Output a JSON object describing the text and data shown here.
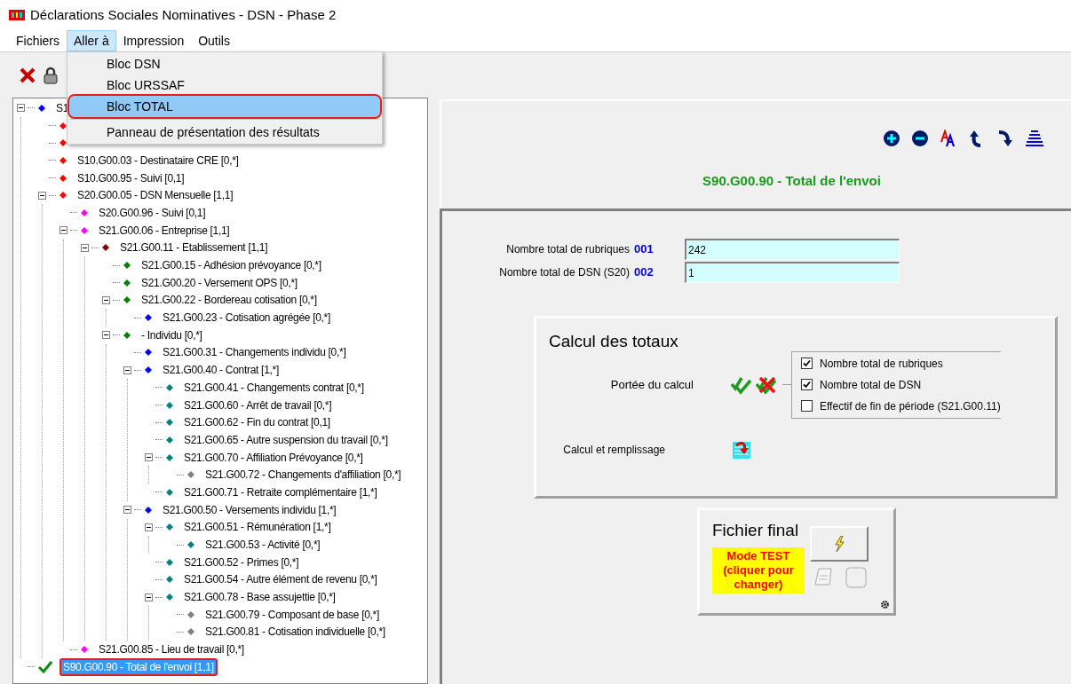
{
  "window": {
    "title": "Déclarations Sociales Nominatives - DSN - Phase 2"
  },
  "menu_bar": [
    {
      "label": "Fichiers",
      "selected": false
    },
    {
      "label": "Aller à",
      "selected": true
    },
    {
      "label": "Impression",
      "selected": false
    },
    {
      "label": "Outils",
      "selected": false
    }
  ],
  "dropdown": [
    {
      "label": "Bloc DSN",
      "selected": false,
      "kind": "item"
    },
    {
      "label": "Bloc URSSAF",
      "selected": false,
      "kind": "item"
    },
    {
      "label": "Bloc TOTAL",
      "selected": true,
      "kind": "item"
    },
    {
      "kind": "separator"
    },
    {
      "label": "Panneau de présentation des résultats",
      "selected": false,
      "kind": "item"
    }
  ],
  "tree": [
    {
      "label": "S1",
      "color": "#0000ff",
      "kind": "diamond",
      "selected": false,
      "expanded": true,
      "children": [
        {
          "color": "#ff0000",
          "kind": "diamond",
          "selected": false
        },
        {
          "color": "#ff0000",
          "kind": "diamond",
          "selected": false
        },
        {
          "label": "S10.G00.03 - Destinataire CRE [0,*]",
          "color": "#ff0000",
          "kind": "diamond",
          "selected": false
        },
        {
          "label": "S10.G00.95 - Suivi [0,1]",
          "color": "#ff0000",
          "kind": "diamond",
          "selected": false
        },
        {
          "label": "S20.G00.05 - DSN Mensuelle [1,1]",
          "color": "#ff0000",
          "kind": "diamond",
          "selected": false,
          "expanded": true,
          "children": [
            {
              "label": "S20.G00.96 - Suivi [0,1]",
              "color": "#ff00ff",
              "kind": "diamond",
              "selected": false
            },
            {
              "label": "S21.G00.06 - Entreprise [1,1]",
              "color": "#ff00ff",
              "kind": "diamond",
              "selected": false,
              "expanded": true,
              "children": [
                {
                  "label": "S21.G00.11 - Etablissement [1,1]",
                  "color": "#800000",
                  "kind": "diamond",
                  "selected": false,
                  "expanded": true,
                  "children": [
                    {
                      "label": "S21.G00.15 - Adhésion prévoyance [0,*]",
                      "color": "#008000",
                      "kind": "diamond",
                      "selected": false
                    },
                    {
                      "label": "S21.G00.20 - Versement OPS [0,*]",
                      "color": "#008000",
                      "kind": "diamond",
                      "selected": false
                    },
                    {
                      "label": "S21.G00.22 - Bordereau cotisation [0,*]",
                      "color": "#008000",
                      "kind": "diamond",
                      "selected": false,
                      "expanded": true,
                      "children": [
                        {
                          "label": "S21.G00.23 - Cotisation agrégée [0,*]",
                          "color": "#0000ff",
                          "kind": "diamond",
                          "selected": false
                        }
                      ]
                    },
                    {
                      "label": "- Individu [0,*]",
                      "color": "#008000",
                      "kind": "diamond",
                      "selected": false,
                      "expanded": true,
                      "children": [
                        {
                          "label": "S21.G00.31 - Changements individu [0,*]",
                          "color": "#0000ff",
                          "kind": "diamond",
                          "selected": false
                        },
                        {
                          "label": "S21.G00.40 - Contrat [1,*]",
                          "color": "#0000ff",
                          "kind": "diamond",
                          "selected": false,
                          "expanded": true,
                          "children": [
                            {
                              "label": "S21.G00.41 - Changements contrat [0,*]",
                              "color": "#008080",
                              "kind": "diamond",
                              "selected": false
                            },
                            {
                              "label": "S21.G00.60 - Arrêt de travail [0,*]",
                              "color": "#008080",
                              "kind": "diamond",
                              "selected": false
                            },
                            {
                              "label": "S21.G00.62 - Fin du contrat [0,1]",
                              "color": "#008080",
                              "kind": "diamond",
                              "selected": false
                            },
                            {
                              "label": "S21.G00.65 - Autre suspension du travail [0,*]",
                              "color": "#008080",
                              "kind": "diamond",
                              "selected": false
                            },
                            {
                              "label": "S21.G00.70 - Affiliation Prévoyance [0,*]",
                              "color": "#008080",
                              "kind": "diamond",
                              "selected": false,
                              "expanded": true,
                              "children": [
                                {
                                  "label": "S21.G00.72 - Changements d'affiliation [0,*]",
                                  "color": "#808080",
                                  "kind": "diamond",
                                  "selected": false
                                }
                              ]
                            },
                            {
                              "label": "S21.G00.71 - Retraite complémentaire [1,*]",
                              "color": "#008080",
                              "kind": "diamond",
                              "selected": false
                            }
                          ]
                        },
                        {
                          "label": "S21.G00.50 - Versements individu [1,*]",
                          "color": "#0000ff",
                          "kind": "diamond",
                          "selected": false,
                          "expanded": true,
                          "children": [
                            {
                              "label": "S21.G00.51 - Rémunération [1,*]",
                              "color": "#008080",
                              "kind": "diamond",
                              "selected": false,
                              "expanded": true,
                              "children": [
                                {
                                  "label": "S21.G00.53 - Activité [0,*]",
                                  "color": "#008080",
                                  "kind": "diamond",
                                  "selected": false
                                }
                              ]
                            },
                            {
                              "label": "S21.G00.52 - Primes [0,*]",
                              "color": "#008080",
                              "kind": "diamond",
                              "selected": false
                            },
                            {
                              "label": "S21.G00.54 - Autre élément de revenu [0,*]",
                              "color": "#008080",
                              "kind": "diamond",
                              "selected": false
                            },
                            {
                              "label": "S21.G00.78 - Base assujettie [0,*]",
                              "color": "#008080",
                              "kind": "diamond",
                              "selected": false,
                              "expanded": true,
                              "children": [
                                {
                                  "label": "S21.G00.79 - Composant de base [0,*]",
                                  "color": "#808080",
                                  "kind": "diamond",
                                  "selected": false
                                },
                                {
                                  "label": "S21.G00.81 - Cotisation individuelle [0,*]",
                                  "color": "#808080",
                                  "kind": "diamond",
                                  "selected": false
                                }
                              ]
                            }
                          ]
                        }
                      ]
                    }
                  ]
                }
              ]
            },
            {
              "label": "S21.G00.85 - Lieu de travail [0,*]",
              "color": "#ff00ff",
              "kind": "diamond",
              "selected": false
            }
          ]
        }
      ]
    },
    {
      "label": "S90.G00.90 - Total de l'envoi [1,1]",
      "kind": "check",
      "selected": true
    }
  ],
  "detail": {
    "title": "S90.G00.90 - Total de l'envoi",
    "fields": [
      {
        "label": "Nombre total de rubriques",
        "code": "001",
        "value": "242"
      },
      {
        "label": "Nombre total de DSN (S20)",
        "code": "002",
        "value": "1"
      }
    ],
    "calc": {
      "title": "Calcul des totaux",
      "scope_label": "Portée du calcul",
      "fill_label": "Calcul  et remplissage",
      "options": [
        {
          "label": "Nombre total de rubriques",
          "checked": true
        },
        {
          "label": "Nombre total de DSN",
          "checked": true
        },
        {
          "label": "Effectif de fin de période (S21.G00.11)",
          "checked": false
        }
      ]
    },
    "final": {
      "title": "Fichier final",
      "mode": "Mode TEST (cliquer pour changer)"
    }
  }
}
